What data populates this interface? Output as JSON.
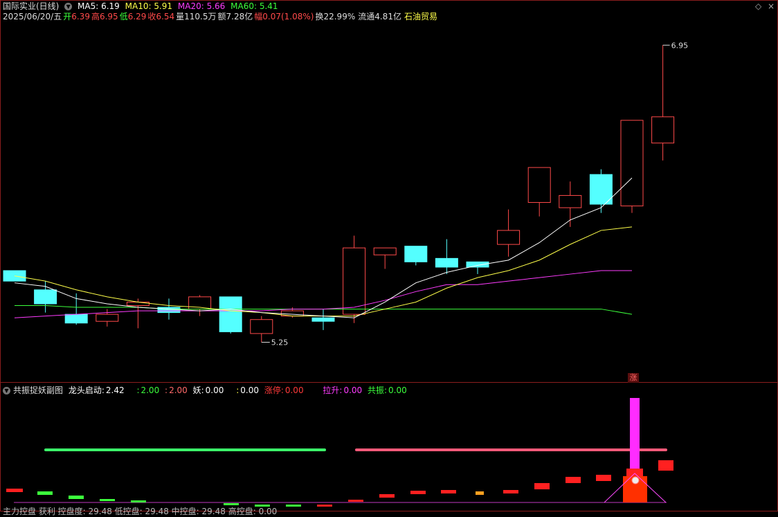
{
  "header": {
    "stock_title": "国际实业(日线)",
    "ma5_label": "MA5: 6.19",
    "ma10_label": "MA10: 5.91",
    "ma20_label": "MA20: 5.66",
    "ma60_label": "MA60: 5.41",
    "date": "2025/06/20/五",
    "open_label": "开",
    "open_value": "6.39",
    "high_label": "高",
    "high_value": "6.95",
    "low_label": "低",
    "low_value": "6.29",
    "close_label": "收",
    "close_value": "6.54",
    "volume": "量110.5万",
    "amount": "额7.28亿",
    "change_label": "幅",
    "change_value": "0.07(1.08%)",
    "turnover": "换22.99%",
    "float": "流通4.81亿",
    "sector": "石油贸易"
  },
  "colors": {
    "up": "#ff4a4a",
    "down": "#54ffff",
    "ma5": "#ffffff",
    "ma10": "#ffff4a",
    "ma20": "#ff3cff",
    "ma60": "#3cff3c",
    "frame": "#8a1d1d"
  },
  "chart_data": {
    "type": "candlestick",
    "price_range": [
      5.07,
      7.05
    ],
    "annotations": {
      "high_label": "6.95",
      "low_label": "5.25"
    },
    "candles": [
      {
        "o": 5.66,
        "h": 5.66,
        "l": 5.6,
        "c": 5.6
      },
      {
        "o": 5.55,
        "h": 5.6,
        "l": 5.42,
        "c": 5.47
      },
      {
        "o": 5.41,
        "h": 5.53,
        "l": 5.35,
        "c": 5.36
      },
      {
        "o": 5.37,
        "h": 5.44,
        "l": 5.34,
        "c": 5.41
      },
      {
        "o": 5.46,
        "h": 5.5,
        "l": 5.33,
        "c": 5.48
      },
      {
        "o": 5.45,
        "h": 5.5,
        "l": 5.38,
        "c": 5.42
      },
      {
        "o": 5.44,
        "h": 5.52,
        "l": 5.4,
        "c": 5.51
      },
      {
        "o": 5.51,
        "h": 5.51,
        "l": 5.3,
        "c": 5.31
      },
      {
        "o": 5.3,
        "h": 5.4,
        "l": 5.25,
        "c": 5.38
      },
      {
        "o": 5.4,
        "h": 5.45,
        "l": 5.39,
        "c": 5.43
      },
      {
        "o": 5.39,
        "h": 5.44,
        "l": 5.32,
        "c": 5.37
      },
      {
        "o": 5.41,
        "h": 5.86,
        "l": 5.36,
        "c": 5.79
      },
      {
        "o": 5.75,
        "h": 5.79,
        "l": 5.67,
        "c": 5.79
      },
      {
        "o": 5.8,
        "h": 5.8,
        "l": 5.69,
        "c": 5.71
      },
      {
        "o": 5.73,
        "h": 5.84,
        "l": 5.64,
        "c": 5.68
      },
      {
        "o": 5.71,
        "h": 5.71,
        "l": 5.64,
        "c": 5.68
      },
      {
        "o": 5.81,
        "h": 6.01,
        "l": 5.74,
        "c": 5.89
      },
      {
        "o": 6.05,
        "h": 6.19,
        "l": 5.97,
        "c": 6.25
      },
      {
        "o": 6.02,
        "h": 6.17,
        "l": 5.91,
        "c": 6.09
      },
      {
        "o": 6.21,
        "h": 6.24,
        "l": 5.99,
        "c": 6.04
      },
      {
        "o": 6.03,
        "h": 6.09,
        "l": 5.99,
        "c": 6.52
      },
      {
        "o": 6.39,
        "h": 6.95,
        "l": 6.29,
        "c": 6.54
      }
    ],
    "ma5": [
      5.59,
      5.57,
      5.5,
      5.47,
      5.45,
      5.44,
      5.43,
      5.44,
      5.42,
      5.41,
      5.4,
      5.39,
      5.48,
      5.59,
      5.65,
      5.69,
      5.72,
      5.82,
      5.95,
      6.02,
      6.19
    ],
    "ma10": [
      5.63,
      5.6,
      5.55,
      5.51,
      5.48,
      5.46,
      5.45,
      5.43,
      5.42,
      5.4,
      5.4,
      5.4,
      5.44,
      5.48,
      5.56,
      5.62,
      5.66,
      5.72,
      5.81,
      5.89,
      5.91
    ],
    "ma20": [
      5.39,
      5.4,
      5.41,
      5.42,
      5.43,
      5.43,
      5.43,
      5.43,
      5.43,
      5.44,
      5.44,
      5.45,
      5.49,
      5.54,
      5.58,
      5.58,
      5.6,
      5.62,
      5.64,
      5.66,
      5.66
    ],
    "ma60": [
      5.46,
      5.46,
      5.45,
      5.45,
      5.45,
      5.44,
      5.44,
      5.44,
      5.44,
      5.44,
      5.44,
      5.44,
      5.44,
      5.44,
      5.44,
      5.44,
      5.44,
      5.44,
      5.44,
      5.44,
      5.41
    ]
  },
  "sub_indicator": {
    "title": "共振捉妖副图",
    "longtou_label": "龙头启动:",
    "longtou_value": "2.42",
    "v1_label": ":",
    "v1_value": "2.00",
    "v2_label": ":",
    "v2_value": "2.00",
    "yao_label": "妖:",
    "yao_value": "0.00",
    "v3_label": ":",
    "v3_value": "0.00",
    "zhangting_label": "涨停:",
    "zhangting_value": "0.00",
    "lasheng_label": "拉升:",
    "lasheng_value": "0.00",
    "gongzhen_label": "共振:",
    "gongzhen_value": "0.00",
    "zhang_mark": "涨"
  },
  "bottom_indicator": {
    "text": "主力控盘  获利  控盘度: 29.48  低控盘: 29.48  中控盘: 29.48  高控盘: 0.00"
  }
}
